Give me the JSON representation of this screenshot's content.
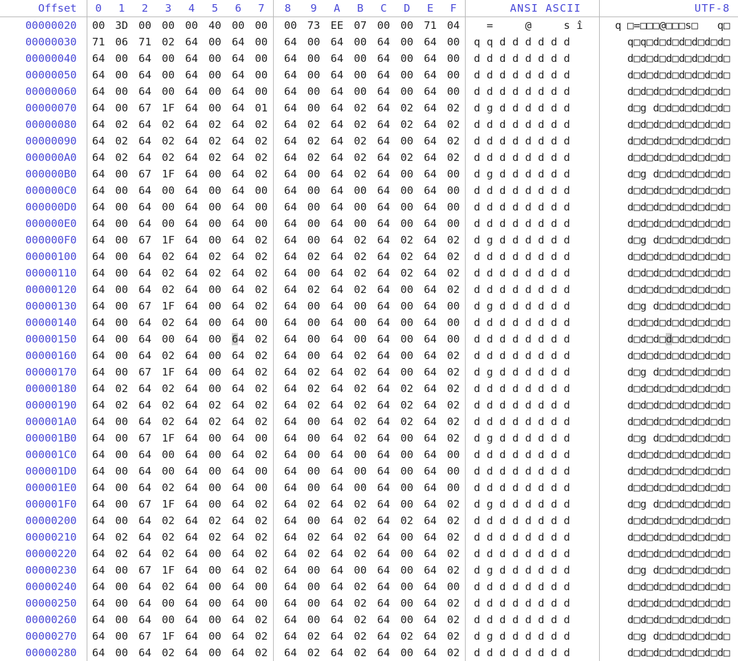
{
  "view": {
    "title": "hex-editor-view",
    "offset_header": "Offset",
    "column_headers": [
      "0",
      "1",
      "2",
      "3",
      "4",
      "5",
      "6",
      "7",
      "8",
      "9",
      "A",
      "B",
      "C",
      "D",
      "E",
      "F"
    ],
    "ansi_header": "ANSI ASCII",
    "utf8_header": "UTF-8",
    "colors": {
      "header_text": "#4a4ad8",
      "offset_text": "#4a4ad8",
      "byte_text": "#222222",
      "rule": "#b9b9b9",
      "selection": "#cfcfcf",
      "background": "#ffffff"
    },
    "selection": {
      "row": "00000150",
      "column": 6,
      "byte": "64",
      "char": "d"
    }
  },
  "rows": [
    {
      "offset": "00000020",
      "bytes": [
        "00",
        "3D",
        "00",
        "00",
        "00",
        "40",
        "00",
        "00",
        "00",
        "73",
        "EE",
        "07",
        "00",
        "00",
        "71",
        "04"
      ],
      "ansi": "  =     @     s î     q",
      "utf8": "□=□□□@□□□s□   q□"
    },
    {
      "offset": "00000030",
      "bytes": [
        "71",
        "06",
        "71",
        "02",
        "64",
        "00",
        "64",
        "00",
        "64",
        "00",
        "64",
        "00",
        "64",
        "00",
        "64",
        "00"
      ],
      "ansi": "q q d d d d d d",
      "utf8": "q□q□d□d□d□d□d□d□"
    },
    {
      "offset": "00000040",
      "bytes": [
        "64",
        "00",
        "64",
        "00",
        "64",
        "00",
        "64",
        "00",
        "64",
        "00",
        "64",
        "00",
        "64",
        "00",
        "64",
        "00"
      ],
      "ansi": "d d d d d d d d",
      "utf8": "d□d□d□d□d□d□d□d□"
    },
    {
      "offset": "00000050",
      "bytes": [
        "64",
        "00",
        "64",
        "00",
        "64",
        "00",
        "64",
        "00",
        "64",
        "00",
        "64",
        "00",
        "64",
        "00",
        "64",
        "00"
      ],
      "ansi": "d d d d d d d d",
      "utf8": "d□d□d□d□d□d□d□d□"
    },
    {
      "offset": "00000060",
      "bytes": [
        "64",
        "00",
        "64",
        "00",
        "64",
        "00",
        "64",
        "00",
        "64",
        "00",
        "64",
        "00",
        "64",
        "00",
        "64",
        "00"
      ],
      "ansi": "d d d d d d d d",
      "utf8": "d□d□d□d□d□d□d□d□"
    },
    {
      "offset": "00000070",
      "bytes": [
        "64",
        "00",
        "67",
        "1F",
        "64",
        "00",
        "64",
        "01",
        "64",
        "00",
        "64",
        "02",
        "64",
        "02",
        "64",
        "02"
      ],
      "ansi": "d g d d d d d d",
      "utf8": "d□g d□d□d□d□d□d□"
    },
    {
      "offset": "00000080",
      "bytes": [
        "64",
        "02",
        "64",
        "02",
        "64",
        "02",
        "64",
        "02",
        "64",
        "02",
        "64",
        "02",
        "64",
        "02",
        "64",
        "02"
      ],
      "ansi": "d d d d d d d d",
      "utf8": "d□d□d□d□d□d□d□d□"
    },
    {
      "offset": "00000090",
      "bytes": [
        "64",
        "02",
        "64",
        "02",
        "64",
        "02",
        "64",
        "02",
        "64",
        "02",
        "64",
        "02",
        "64",
        "00",
        "64",
        "02"
      ],
      "ansi": "d d d d d d d d",
      "utf8": "d□d□d□d□d□d□d□d□"
    },
    {
      "offset": "000000A0",
      "bytes": [
        "64",
        "02",
        "64",
        "02",
        "64",
        "02",
        "64",
        "02",
        "64",
        "02",
        "64",
        "02",
        "64",
        "02",
        "64",
        "02"
      ],
      "ansi": "d d d d d d d d",
      "utf8": "d□d□d□d□d□d□d□d□"
    },
    {
      "offset": "000000B0",
      "bytes": [
        "64",
        "00",
        "67",
        "1F",
        "64",
        "00",
        "64",
        "02",
        "64",
        "00",
        "64",
        "02",
        "64",
        "00",
        "64",
        "00"
      ],
      "ansi": "d g d d d d d d",
      "utf8": "d□g d□d□d□d□d□d□"
    },
    {
      "offset": "000000C0",
      "bytes": [
        "64",
        "00",
        "64",
        "00",
        "64",
        "00",
        "64",
        "00",
        "64",
        "00",
        "64",
        "00",
        "64",
        "00",
        "64",
        "00"
      ],
      "ansi": "d d d d d d d d",
      "utf8": "d□d□d□d□d□d□d□d□"
    },
    {
      "offset": "000000D0",
      "bytes": [
        "64",
        "00",
        "64",
        "00",
        "64",
        "00",
        "64",
        "00",
        "64",
        "00",
        "64",
        "00",
        "64",
        "00",
        "64",
        "00"
      ],
      "ansi": "d d d d d d d d",
      "utf8": "d□d□d□d□d□d□d□d□"
    },
    {
      "offset": "000000E0",
      "bytes": [
        "64",
        "00",
        "64",
        "00",
        "64",
        "00",
        "64",
        "00",
        "64",
        "00",
        "64",
        "00",
        "64",
        "00",
        "64",
        "00"
      ],
      "ansi": "d d d d d d d d",
      "utf8": "d□d□d□d□d□d□d□d□"
    },
    {
      "offset": "000000F0",
      "bytes": [
        "64",
        "00",
        "67",
        "1F",
        "64",
        "00",
        "64",
        "02",
        "64",
        "00",
        "64",
        "02",
        "64",
        "02",
        "64",
        "02"
      ],
      "ansi": "d g d d d d d d",
      "utf8": "d□g d□d□d□d□d□d□"
    },
    {
      "offset": "00000100",
      "bytes": [
        "64",
        "00",
        "64",
        "02",
        "64",
        "02",
        "64",
        "02",
        "64",
        "02",
        "64",
        "02",
        "64",
        "02",
        "64",
        "02"
      ],
      "ansi": "d d d d d d d d",
      "utf8": "d□d□d□d□d□d□d□d□"
    },
    {
      "offset": "00000110",
      "bytes": [
        "64",
        "00",
        "64",
        "02",
        "64",
        "02",
        "64",
        "02",
        "64",
        "00",
        "64",
        "02",
        "64",
        "02",
        "64",
        "02"
      ],
      "ansi": "d d d d d d d d",
      "utf8": "d□d□d□d□d□d□d□d□"
    },
    {
      "offset": "00000120",
      "bytes": [
        "64",
        "00",
        "64",
        "02",
        "64",
        "00",
        "64",
        "02",
        "64",
        "02",
        "64",
        "02",
        "64",
        "00",
        "64",
        "02"
      ],
      "ansi": "d d d d d d d d",
      "utf8": "d□d□d□d□d□d□d□d□"
    },
    {
      "offset": "00000130",
      "bytes": [
        "64",
        "00",
        "67",
        "1F",
        "64",
        "00",
        "64",
        "02",
        "64",
        "00",
        "64",
        "00",
        "64",
        "00",
        "64",
        "00"
      ],
      "ansi": "d g d d d d d d",
      "utf8": "d□g d□d□d□d□d□d□"
    },
    {
      "offset": "00000140",
      "bytes": [
        "64",
        "00",
        "64",
        "02",
        "64",
        "00",
        "64",
        "00",
        "64",
        "00",
        "64",
        "00",
        "64",
        "00",
        "64",
        "00"
      ],
      "ansi": "d d d d d d d d",
      "utf8": "d□d□d□d□d□d□d□d□"
    },
    {
      "offset": "00000150",
      "bytes": [
        "64",
        "00",
        "64",
        "00",
        "64",
        "00",
        "64",
        "02",
        "64",
        "00",
        "64",
        "00",
        "64",
        "00",
        "64",
        "00"
      ],
      "ansi": "d d d d d d d d",
      "utf8": "d□d□d□d□d□d□d□d□"
    },
    {
      "offset": "00000160",
      "bytes": [
        "64",
        "00",
        "64",
        "02",
        "64",
        "00",
        "64",
        "02",
        "64",
        "00",
        "64",
        "02",
        "64",
        "00",
        "64",
        "02"
      ],
      "ansi": "d d d d d d d d",
      "utf8": "d□d□d□d□d□d□d□d□"
    },
    {
      "offset": "00000170",
      "bytes": [
        "64",
        "00",
        "67",
        "1F",
        "64",
        "00",
        "64",
        "02",
        "64",
        "02",
        "64",
        "02",
        "64",
        "00",
        "64",
        "02"
      ],
      "ansi": "d g d d d d d d",
      "utf8": "d□g d□d□d□d□d□d□"
    },
    {
      "offset": "00000180",
      "bytes": [
        "64",
        "02",
        "64",
        "02",
        "64",
        "00",
        "64",
        "02",
        "64",
        "02",
        "64",
        "02",
        "64",
        "02",
        "64",
        "02"
      ],
      "ansi": "d d d d d d d d",
      "utf8": "d□d□d□d□d□d□d□d□"
    },
    {
      "offset": "00000190",
      "bytes": [
        "64",
        "02",
        "64",
        "02",
        "64",
        "02",
        "64",
        "02",
        "64",
        "02",
        "64",
        "02",
        "64",
        "02",
        "64",
        "02"
      ],
      "ansi": "d d d d d d d d",
      "utf8": "d□d□d□d□d□d□d□d□"
    },
    {
      "offset": "000001A0",
      "bytes": [
        "64",
        "00",
        "64",
        "02",
        "64",
        "02",
        "64",
        "02",
        "64",
        "00",
        "64",
        "02",
        "64",
        "02",
        "64",
        "02"
      ],
      "ansi": "d d d d d d d d",
      "utf8": "d□d□d□d□d□d□d□d□"
    },
    {
      "offset": "000001B0",
      "bytes": [
        "64",
        "00",
        "67",
        "1F",
        "64",
        "00",
        "64",
        "00",
        "64",
        "00",
        "64",
        "02",
        "64",
        "00",
        "64",
        "02"
      ],
      "ansi": "d g d d d d d d",
      "utf8": "d□g d□d□d□d□d□d□"
    },
    {
      "offset": "000001C0",
      "bytes": [
        "64",
        "00",
        "64",
        "00",
        "64",
        "00",
        "64",
        "02",
        "64",
        "00",
        "64",
        "00",
        "64",
        "00",
        "64",
        "00"
      ],
      "ansi": "d d d d d d d d",
      "utf8": "d□d□d□d□d□d□d□d□"
    },
    {
      "offset": "000001D0",
      "bytes": [
        "64",
        "00",
        "64",
        "00",
        "64",
        "00",
        "64",
        "00",
        "64",
        "00",
        "64",
        "00",
        "64",
        "00",
        "64",
        "00"
      ],
      "ansi": "d d d d d d d d",
      "utf8": "d□d□d□d□d□d□d□d□"
    },
    {
      "offset": "000001E0",
      "bytes": [
        "64",
        "00",
        "64",
        "02",
        "64",
        "00",
        "64",
        "00",
        "64",
        "00",
        "64",
        "00",
        "64",
        "00",
        "64",
        "00"
      ],
      "ansi": "d d d d d d d d",
      "utf8": "d□d□d□d□d□d□d□d□"
    },
    {
      "offset": "000001F0",
      "bytes": [
        "64",
        "00",
        "67",
        "1F",
        "64",
        "00",
        "64",
        "02",
        "64",
        "02",
        "64",
        "02",
        "64",
        "00",
        "64",
        "02"
      ],
      "ansi": "d g d d d d d d",
      "utf8": "d□g d□d□d□d□d□d□"
    },
    {
      "offset": "00000200",
      "bytes": [
        "64",
        "00",
        "64",
        "02",
        "64",
        "02",
        "64",
        "02",
        "64",
        "00",
        "64",
        "02",
        "64",
        "02",
        "64",
        "02"
      ],
      "ansi": "d d d d d d d d",
      "utf8": "d□d□d□d□d□d□d□d□"
    },
    {
      "offset": "00000210",
      "bytes": [
        "64",
        "02",
        "64",
        "02",
        "64",
        "02",
        "64",
        "02",
        "64",
        "02",
        "64",
        "02",
        "64",
        "00",
        "64",
        "02"
      ],
      "ansi": "d d d d d d d d",
      "utf8": "d□d□d□d□d□d□d□d□"
    },
    {
      "offset": "00000220",
      "bytes": [
        "64",
        "02",
        "64",
        "02",
        "64",
        "00",
        "64",
        "02",
        "64",
        "02",
        "64",
        "02",
        "64",
        "00",
        "64",
        "02"
      ],
      "ansi": "d d d d d d d d",
      "utf8": "d□d□d□d□d□d□d□d□"
    },
    {
      "offset": "00000230",
      "bytes": [
        "64",
        "00",
        "67",
        "1F",
        "64",
        "00",
        "64",
        "02",
        "64",
        "00",
        "64",
        "00",
        "64",
        "00",
        "64",
        "02"
      ],
      "ansi": "d g d d d d d d",
      "utf8": "d□g d□d□d□d□d□d□"
    },
    {
      "offset": "00000240",
      "bytes": [
        "64",
        "00",
        "64",
        "02",
        "64",
        "00",
        "64",
        "00",
        "64",
        "00",
        "64",
        "02",
        "64",
        "00",
        "64",
        "00"
      ],
      "ansi": "d d d d d d d d",
      "utf8": "d□d□d□d□d□d□d□d□"
    },
    {
      "offset": "00000250",
      "bytes": [
        "64",
        "00",
        "64",
        "00",
        "64",
        "00",
        "64",
        "00",
        "64",
        "00",
        "64",
        "02",
        "64",
        "00",
        "64",
        "02"
      ],
      "ansi": "d d d d d d d d",
      "utf8": "d□d□d□d□d□d□d□d□"
    },
    {
      "offset": "00000260",
      "bytes": [
        "64",
        "00",
        "64",
        "00",
        "64",
        "00",
        "64",
        "02",
        "64",
        "00",
        "64",
        "02",
        "64",
        "00",
        "64",
        "02"
      ],
      "ansi": "d d d d d d d d",
      "utf8": "d□d□d□d□d□d□d□d□"
    },
    {
      "offset": "00000270",
      "bytes": [
        "64",
        "00",
        "67",
        "1F",
        "64",
        "00",
        "64",
        "02",
        "64",
        "02",
        "64",
        "02",
        "64",
        "02",
        "64",
        "02"
      ],
      "ansi": "d g d d d d d d",
      "utf8": "d□g d□d□d□d□d□d□"
    },
    {
      "offset": "00000280",
      "bytes": [
        "64",
        "00",
        "64",
        "02",
        "64",
        "00",
        "64",
        "02",
        "64",
        "02",
        "64",
        "02",
        "64",
        "00",
        "64",
        "02"
      ],
      "ansi": "d d d d d d d d",
      "utf8": "d□d□d□d□d□d□d□d□"
    }
  ]
}
